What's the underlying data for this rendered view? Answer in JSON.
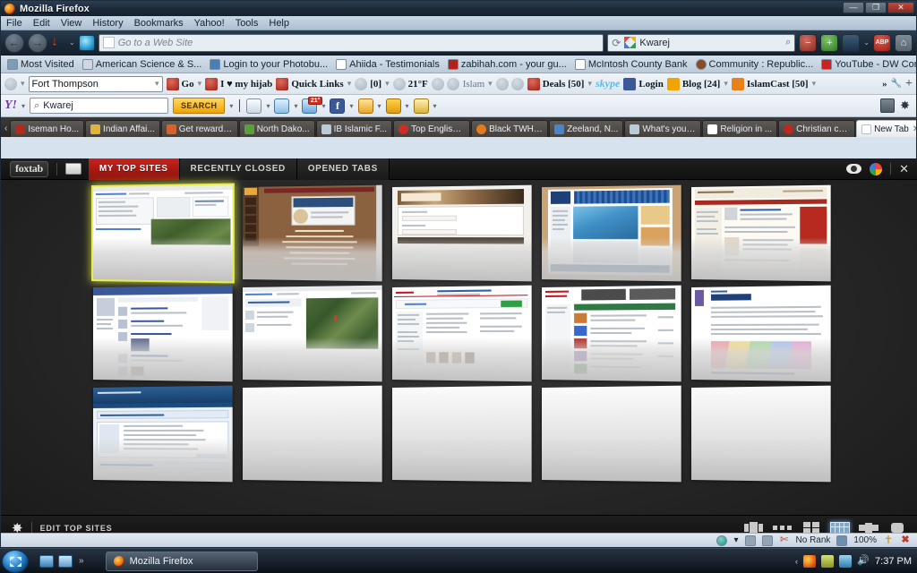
{
  "window": {
    "title": "Mozilla Firefox",
    "minimize_label": "—",
    "maximize_label": "❐",
    "close_label": "✕"
  },
  "menubar": {
    "items": [
      "File",
      "Edit",
      "View",
      "History",
      "Bookmarks",
      "Yahoo!",
      "Tools",
      "Help"
    ]
  },
  "navbar": {
    "back_label": "←",
    "forward_label": "→",
    "download_label": "↓",
    "dropdown_caret": "⌄",
    "url_placeholder": "Go to a Web Site",
    "url_value": "",
    "go_caret": "⟳",
    "search_value": "Kwarej",
    "search_icon": "⌕",
    "zoom_out_label": "−",
    "zoom_in_label": "+",
    "hat_label": "",
    "abp_label": "ABP",
    "abp_caret": "⌄",
    "home_label": "⌂"
  },
  "bookmarks": {
    "overflow_label": "»",
    "items": [
      {
        "label": "Most Visited",
        "icon": "star-icon",
        "color": "#7f9bb5"
      },
      {
        "label": "American Science & S...",
        "icon": "globe-icon",
        "color": "#cfd8e0"
      },
      {
        "label": "Login to your Photobu...",
        "icon": "photo-icon",
        "color": "#4a7fb5"
      },
      {
        "label": "Ahiida - Testimonials",
        "icon": "page-icon",
        "color": "#ffffff"
      },
      {
        "label": "zabihah.com - your gu...",
        "icon": "crescent-icon",
        "color": "#b4211a"
      },
      {
        "label": "McIntosh County Bank",
        "icon": "page-icon",
        "color": "#ffffff"
      },
      {
        "label": "Community : Republic...",
        "icon": "feather-icon",
        "color": "#8c4a1f"
      },
      {
        "label": "YouTube - DW Compa...",
        "icon": "youtube-icon",
        "color": "#cc2222"
      }
    ]
  },
  "google_toolbar": {
    "logo_icon": "google-toolbar-icon",
    "location_value": "Fort Thompson",
    "location_caret": "▾",
    "go_label": "Go",
    "hijab_label": "I ♥ my hijab",
    "quick_links_label": "Quick Links",
    "mail_count_label": "[0]",
    "temperature_label": "21°F",
    "islam_label": "Islam",
    "deals_label": "Deals [50]",
    "skype_label": "skype",
    "login_label": "Login",
    "blog_label": "Blog [24]",
    "islamcast_label": "IslamCast [50]",
    "overflow_label": "»",
    "wrench_label": "🔧",
    "plus_label": "+",
    "caret": "▾"
  },
  "yahoo_toolbar": {
    "logo_label": "Y!",
    "search_value": "Kwarej",
    "search_icon": "⌕",
    "search_button_label": "SEARCH",
    "weather_badge": "21°",
    "caret": "▾",
    "icons": [
      "document-icon",
      "mail-icon",
      "weather-icon",
      "facebook-icon",
      "notepad-icon",
      "plug-icon",
      "lock-icon"
    ]
  },
  "tabs": {
    "scroll_left_label": "‹",
    "scroll_right_label": "›",
    "new_tab_label": "+",
    "list_all_label": "▾",
    "close_label": "✕",
    "items": [
      {
        "label": "Iseman Ho...",
        "color": "#b02a1f",
        "active": false
      },
      {
        "label": "Indian Affai...",
        "color": "#e0b33a",
        "active": false
      },
      {
        "label": "Get rewarde...",
        "color": "#d4622a",
        "active": false
      },
      {
        "label": "North Dako...",
        "color": "#5a9f3c",
        "active": false
      },
      {
        "label": "IB Islamic F...",
        "color": "#b9cad8",
        "active": false
      },
      {
        "label": "Top English...",
        "color": "#cf2c22",
        "active": false
      },
      {
        "label": "Black TWH ...",
        "color": "#e07b1f",
        "active": false
      },
      {
        "label": "Zeeland, N...",
        "color": "#4a86c7",
        "active": false
      },
      {
        "label": "What's your...",
        "color": "#b9cad8",
        "active": false
      },
      {
        "label": "Religion in ...",
        "color": "#ffffff",
        "active": false
      },
      {
        "label": "Christian ch...",
        "color": "#c0281e",
        "active": false
      },
      {
        "label": "New Tab",
        "color": "#ffffff",
        "active": true
      }
    ]
  },
  "foxtab": {
    "logo_label": "foxtab",
    "folder_icon": "folder-icon",
    "tabs": [
      {
        "label": "MY TOP SITES",
        "active": true
      },
      {
        "label": "RECENTLY CLOSED",
        "active": false
      },
      {
        "label": "OPENED TABS",
        "active": false
      }
    ],
    "eye_icon": "eye-icon",
    "orb_icon": "colorwheel-icon",
    "close_label": "✕",
    "footer": {
      "gear_icon": "gear-icon",
      "edit_label": "EDIT TOP SITES",
      "views": [
        {
          "name": "view-wall",
          "active": false
        },
        {
          "name": "view-list",
          "active": false
        },
        {
          "name": "view-grid",
          "active": false
        },
        {
          "name": "view-table",
          "active": true
        },
        {
          "name": "view-carousel",
          "active": false
        },
        {
          "name": "view-stack",
          "active": false
        }
      ]
    },
    "grid": {
      "columns": 5,
      "rows": 3,
      "cells": [
        {
          "name": "thumb-google-maps-search",
          "kind": "search-map",
          "selected": true,
          "empty": false
        },
        {
          "name": "thumb-islamic-brown-site",
          "kind": "brown-article",
          "selected": false,
          "empty": false
        },
        {
          "name": "thumb-login-form-site",
          "kind": "login-form",
          "selected": false,
          "empty": false
        },
        {
          "name": "thumb-blue-portal-site",
          "kind": "blue-portal",
          "selected": false,
          "empty": false
        },
        {
          "name": "thumb-forum-beige-site",
          "kind": "beige-article",
          "selected": false,
          "empty": false
        },
        {
          "name": "thumb-facebook-feed",
          "kind": "social-feed",
          "selected": false,
          "empty": false
        },
        {
          "name": "thumb-google-map-result",
          "kind": "map-result",
          "selected": false,
          "empty": false
        },
        {
          "name": "thumb-shopping-listing",
          "kind": "shopping-list",
          "selected": false,
          "empty": false
        },
        {
          "name": "thumb-news-listing",
          "kind": "news-list",
          "selected": false,
          "empty": false
        },
        {
          "name": "thumb-state-court-map",
          "kind": "court-map",
          "selected": false,
          "empty": false
        },
        {
          "name": "thumb-islamic-board-forum",
          "kind": "forum-blue",
          "selected": false,
          "empty": false
        },
        {
          "name": "thumb-empty-slot",
          "kind": "empty",
          "selected": false,
          "empty": true
        },
        {
          "name": "thumb-empty-slot",
          "kind": "empty",
          "selected": false,
          "empty": true
        },
        {
          "name": "thumb-empty-slot",
          "kind": "empty",
          "selected": false,
          "empty": true
        },
        {
          "name": "thumb-empty-slot",
          "kind": "empty",
          "selected": false,
          "empty": true
        }
      ]
    }
  },
  "statusbar": {
    "rank_label": "No Rank",
    "zoom_label": "100%",
    "caret": "▾"
  },
  "taskbar": {
    "start_label": "",
    "quick_launch_overflow": "»",
    "window_button_label": "Mozilla Firefox",
    "tray_chevron": "‹",
    "clock": "7:37 PM"
  }
}
